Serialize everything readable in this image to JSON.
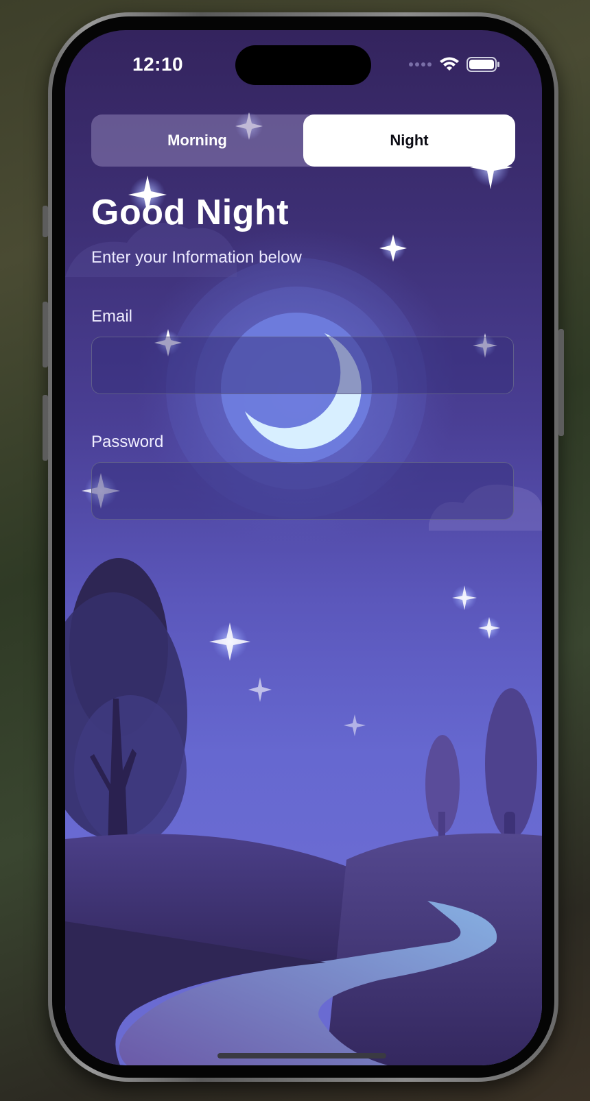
{
  "status_bar": {
    "time": "12:10",
    "icons": [
      "signal-dots-icon",
      "wifi-icon",
      "battery-icon"
    ]
  },
  "mode_toggle": {
    "options": [
      "Morning",
      "Night"
    ],
    "selected": "Night"
  },
  "header": {
    "title": "Good Night",
    "subtitle": "Enter your Information below"
  },
  "form": {
    "email": {
      "label": "Email",
      "value": ""
    },
    "password": {
      "label": "Password",
      "value": ""
    }
  },
  "theme": {
    "sky_top": "#34245e",
    "sky_bottom": "#6a6bd2",
    "moon": "#d8efff",
    "hill": "#3a2e66",
    "river": "#7f9fd6",
    "toggle_active_bg": "#ffffff"
  }
}
